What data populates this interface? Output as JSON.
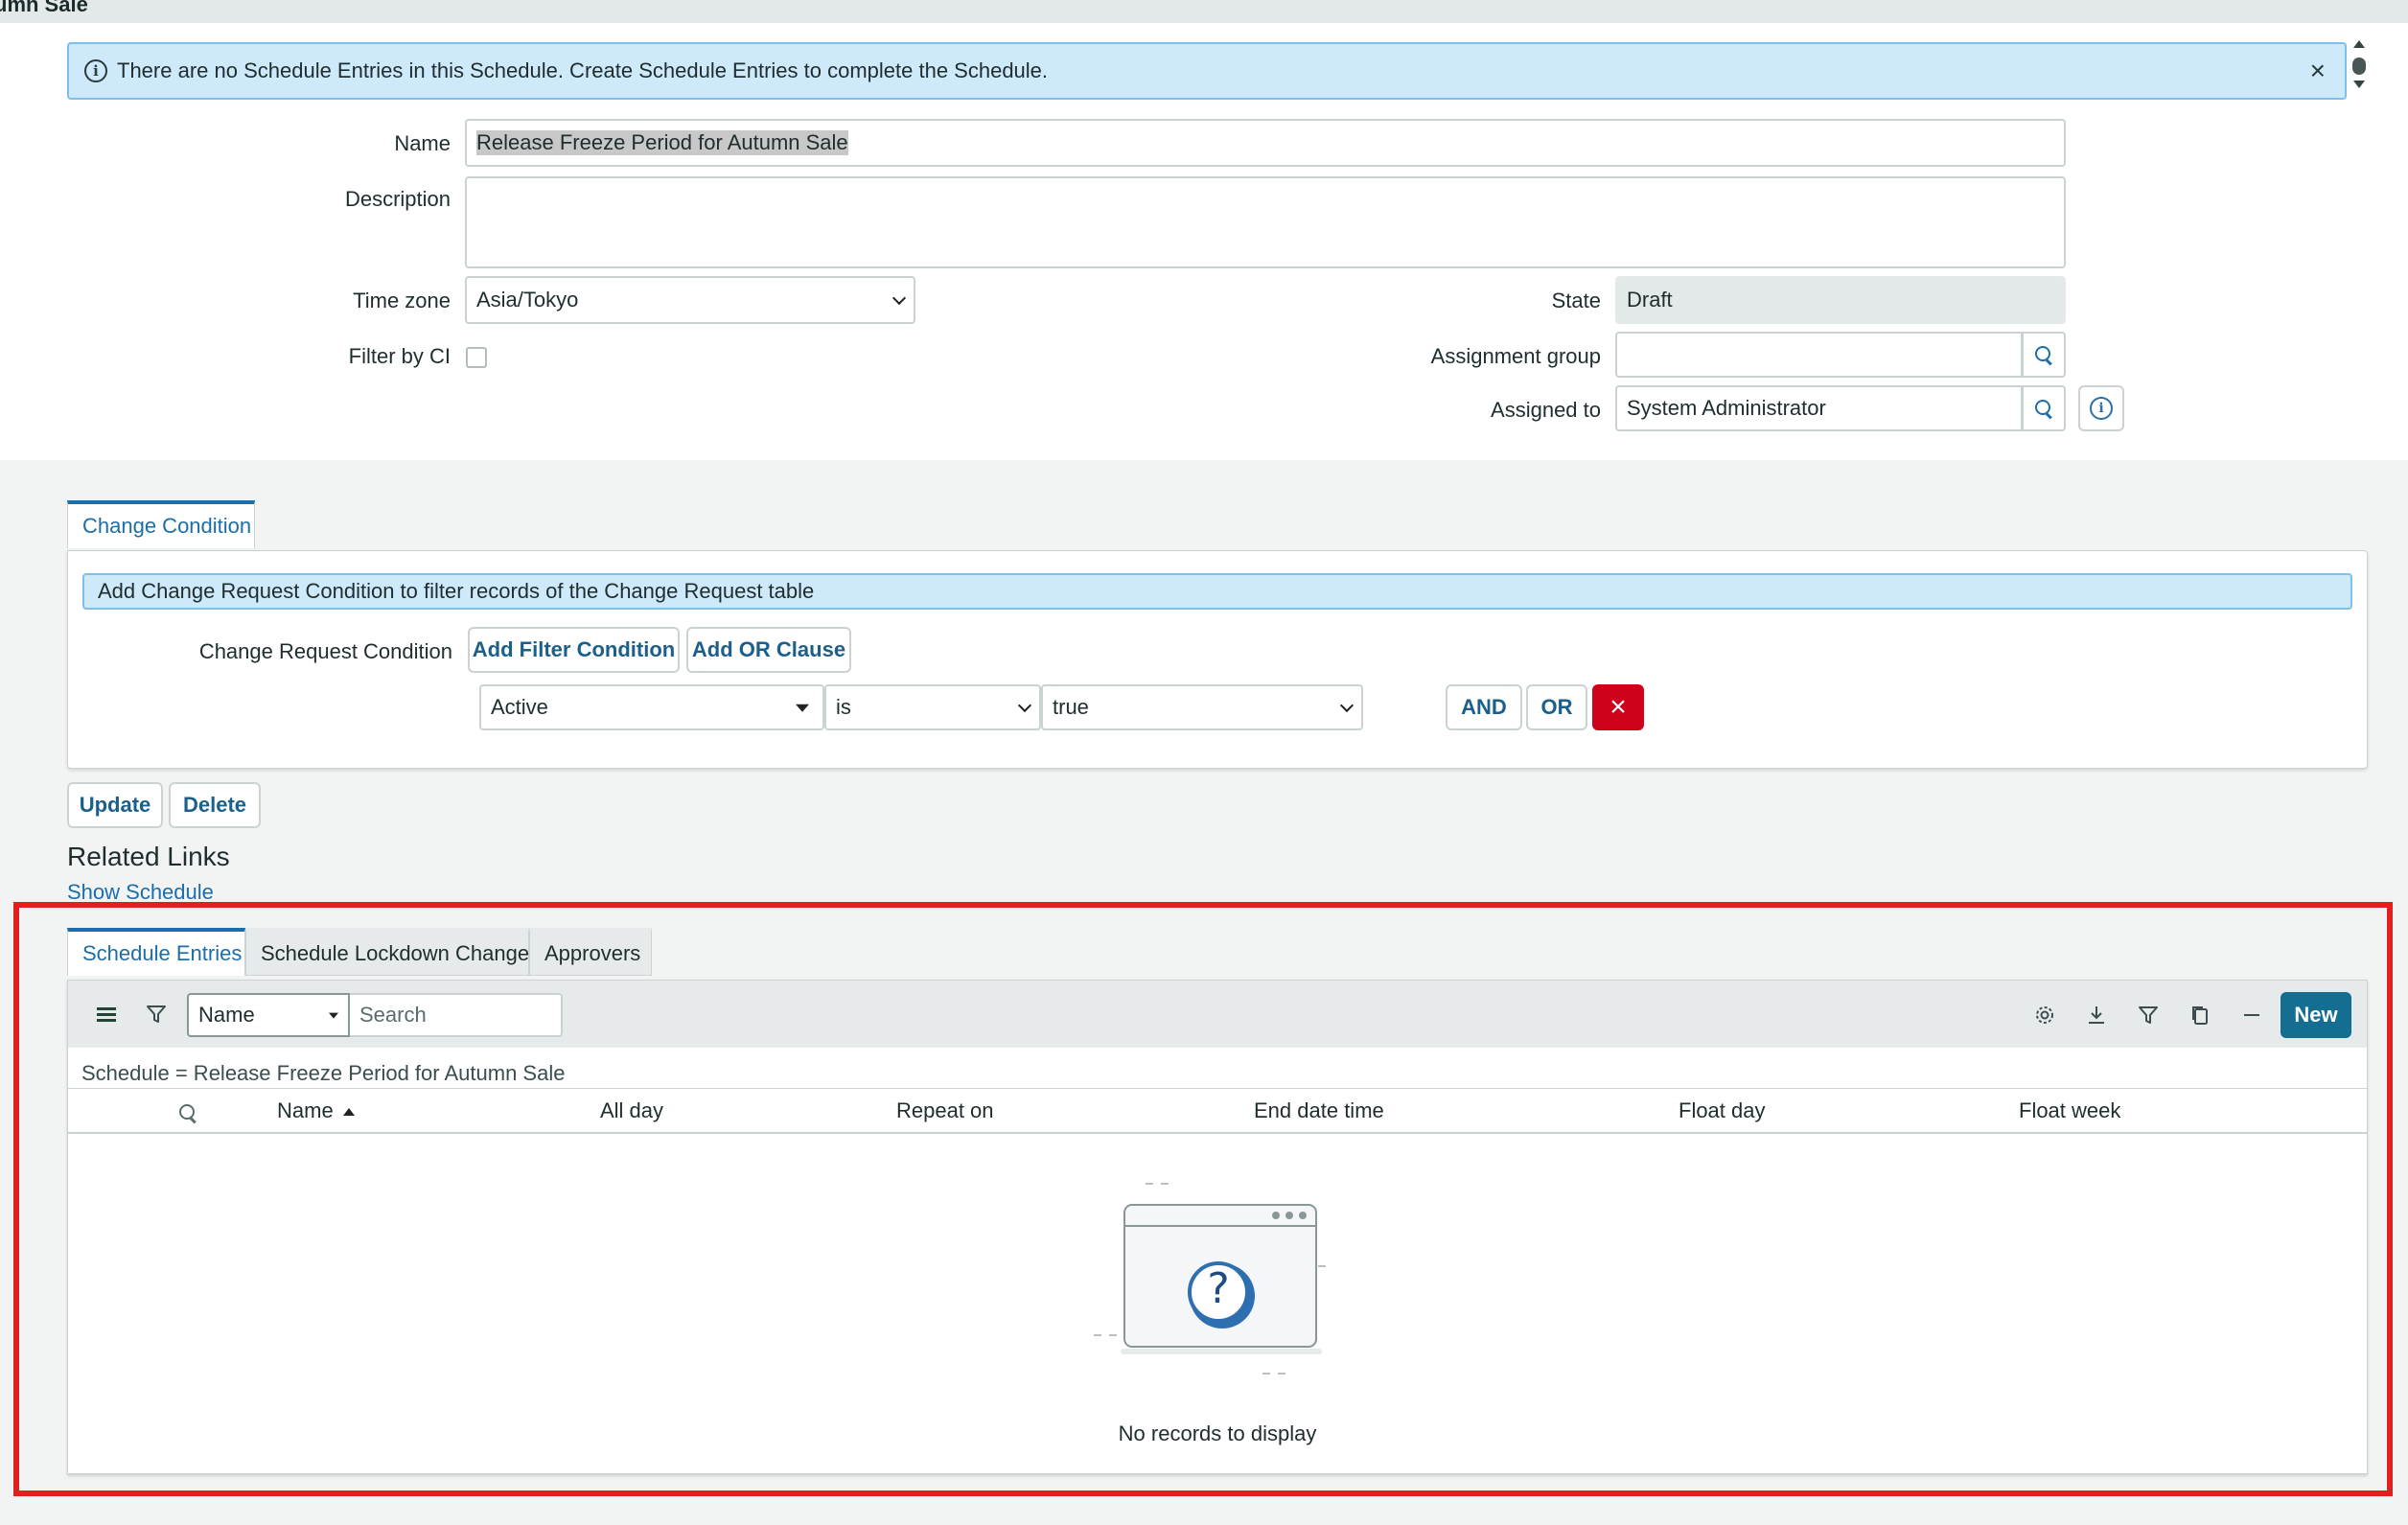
{
  "page": {
    "title_fragment": "umn Sale"
  },
  "banner": {
    "message": "There are no Schedule Entries in this Schedule. Create Schedule Entries to complete the Schedule.",
    "close": "×"
  },
  "form": {
    "name_label": "Name",
    "name_value": "Release Freeze Period for Autumn Sale",
    "description_label": "Description",
    "description_value": "",
    "timezone_label": "Time zone",
    "timezone_value": "Asia/Tokyo",
    "filter_ci_label": "Filter by CI",
    "state_label": "State",
    "state_value": "Draft",
    "assignment_group_label": "Assignment group",
    "assignment_group_value": "",
    "assigned_to_label": "Assigned to",
    "assigned_to_value": "System Administrator"
  },
  "condition": {
    "tab_label": "Change Condition",
    "info": "Add Change Request Condition to filter records of the Change Request table",
    "field_label": "Change Request Condition",
    "add_filter": "Add Filter Condition",
    "add_or": "Add OR Clause",
    "field": "Active",
    "operator": "is",
    "value": "true",
    "and_label": "AND",
    "or_label": "OR",
    "delete_icon": "×"
  },
  "actions": {
    "update": "Update",
    "delete": "Delete"
  },
  "related": {
    "title": "Related Links",
    "show_schedule": "Show Schedule"
  },
  "related_list": {
    "tabs": [
      {
        "label": "Schedule Entries",
        "active": true
      },
      {
        "label": "Schedule Lockdown Changes",
        "active": false
      },
      {
        "label": "Approvers",
        "active": false
      }
    ],
    "search_field": "Name",
    "search_placeholder": "Search",
    "new_label": "New",
    "breadcrumb": "Schedule = Release Freeze Period for Autumn Sale",
    "columns": [
      "Name",
      "All day",
      "Repeat on",
      "End date time",
      "Float day",
      "Float week"
    ],
    "sorted_column": "Name",
    "empty_message": "No records to display",
    "empty_icon": "?"
  },
  "colors": {
    "accent": "#1b6ea8",
    "new_button": "#136e91",
    "delete_button": "#d0021b",
    "info_bg": "#cde9fa",
    "highlight_box": "#e02020"
  }
}
